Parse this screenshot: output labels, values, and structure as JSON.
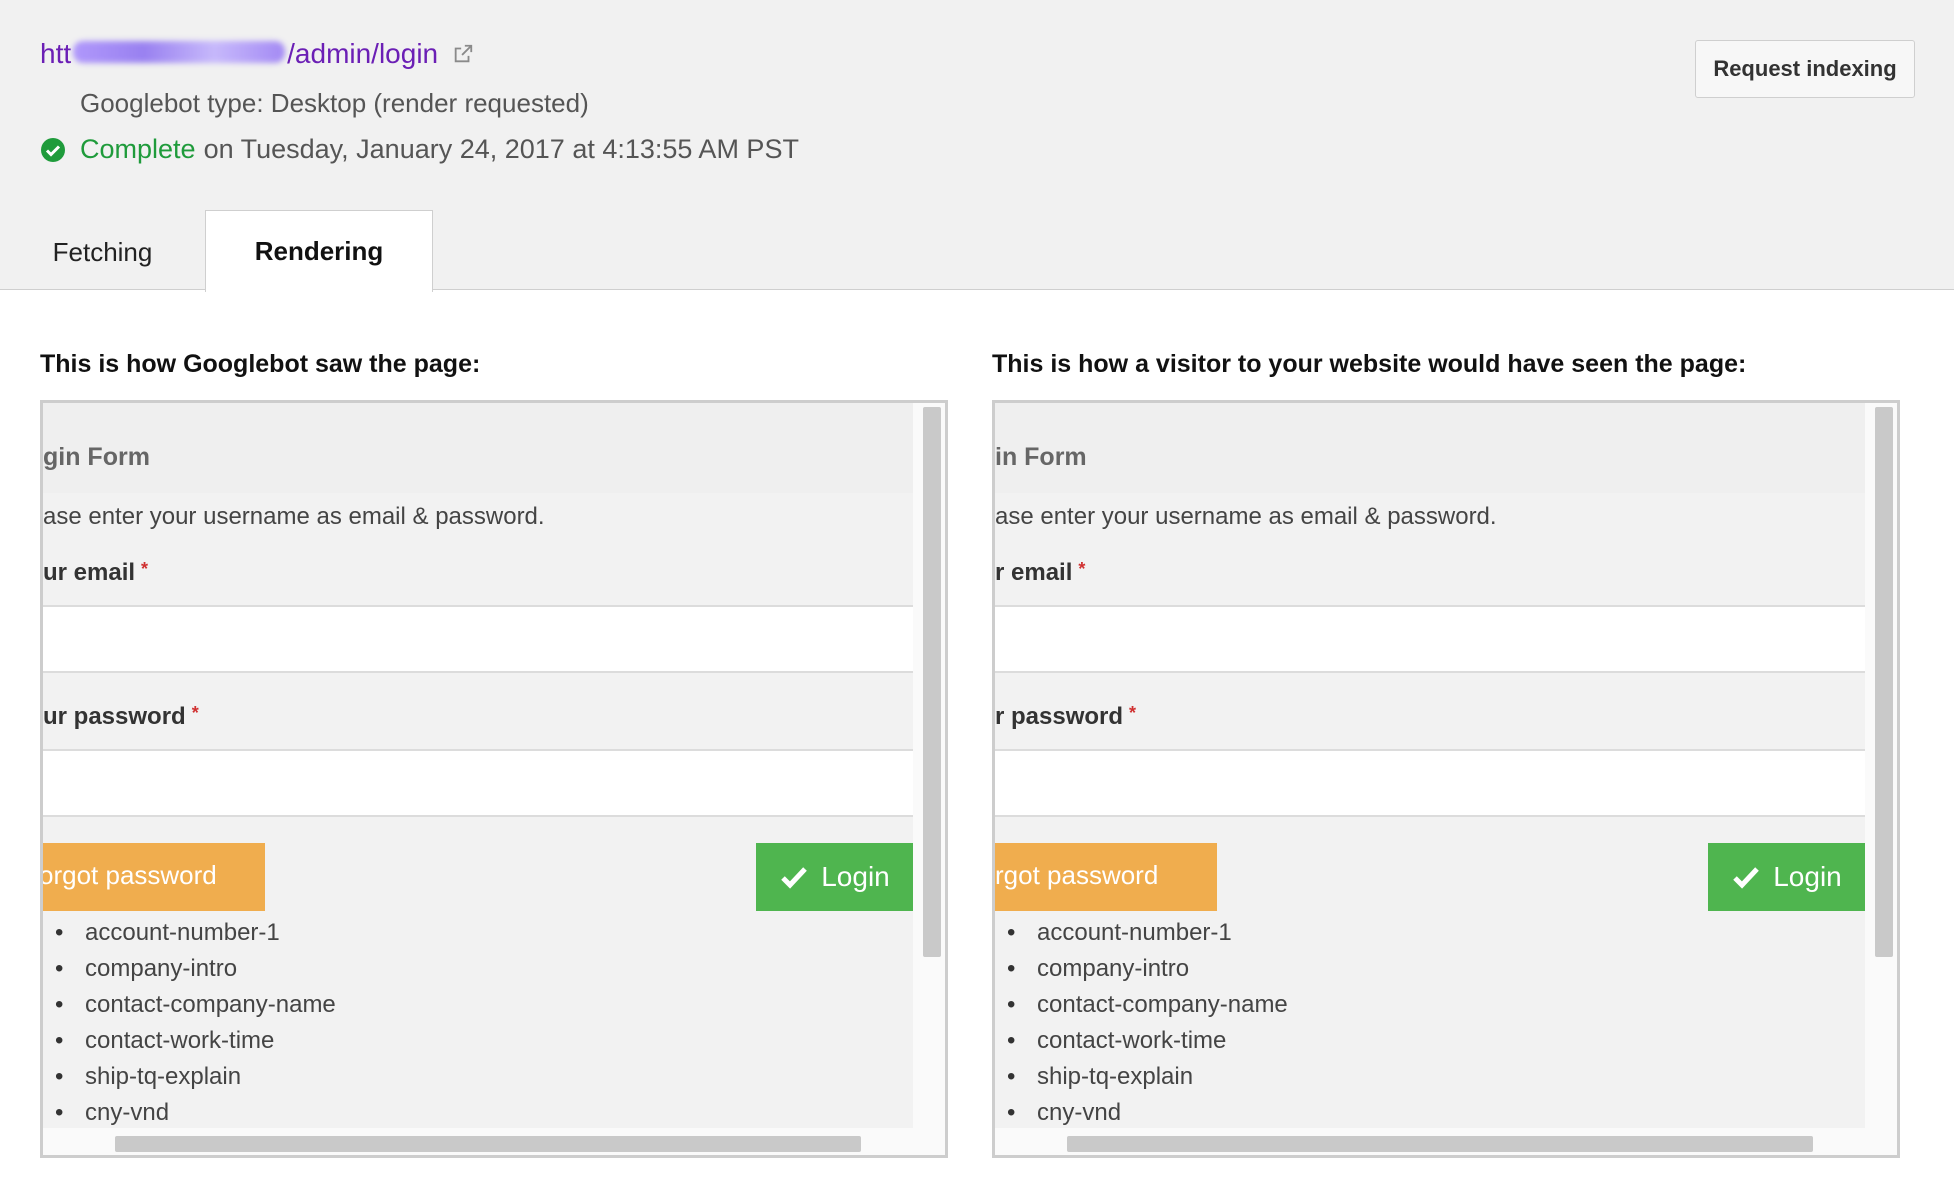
{
  "header": {
    "url_prefix": "htt",
    "url_suffix": "/admin/login",
    "googlebot_type": "Googlebot type: Desktop (render requested)",
    "status_word": "Complete",
    "status_rest": "on Tuesday, January 24, 2017 at 4:13:55 AM PST",
    "request_indexing_label": "Request indexing"
  },
  "tabs": [
    {
      "label": "Fetching",
      "active": false
    },
    {
      "label": "Rendering",
      "active": true
    }
  ],
  "panels": [
    {
      "title": "This is how Googlebot saw the page:",
      "form_title": "gin Form",
      "instructions": "ase enter your username as email & password.",
      "email_label": "ur email",
      "password_label": "ur password",
      "required_mark": "*",
      "forgot_label": "orgot password",
      "login_label": "Login",
      "list_items": [
        "account-number-1",
        "company-intro",
        "contact-company-name",
        "contact-work-time",
        "ship-tq-explain",
        "cny-vnd"
      ]
    },
    {
      "title": "This is how a visitor to your website would have seen the page:",
      "form_title": "in Form",
      "instructions": "ase enter your username as email & password.",
      "email_label": "r email",
      "password_label": "r password",
      "required_mark": "*",
      "forgot_label": "rgot password",
      "login_label": "Login",
      "list_items": [
        "account-number-1",
        "company-intro",
        "contact-company-name",
        "contact-work-time",
        "ship-tq-explain",
        "cny-vnd"
      ]
    }
  ],
  "colors": {
    "link": "#6b1fb5",
    "complete": "#1f9b3b",
    "forgot_button": "#f0ad4e",
    "login_button": "#4fb54f",
    "required": "#d03030"
  },
  "icons": {
    "external_link": "external-link-icon",
    "status": "check-circle-icon",
    "login": "checkmark-icon"
  }
}
